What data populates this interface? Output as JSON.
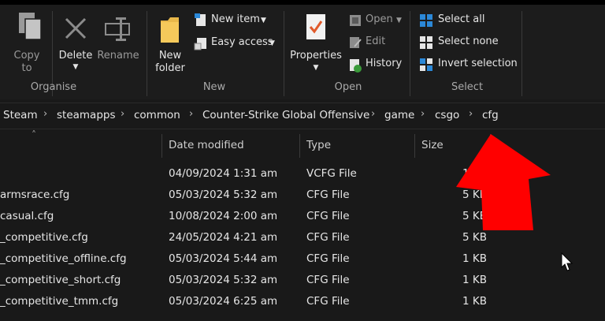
{
  "ribbon": {
    "organise": {
      "label": "Organise",
      "copy_to": "Copy\nto",
      "copy_to_line1": "Copy",
      "copy_to_line2": "to",
      "delete": "Delete",
      "rename": "Rename"
    },
    "new": {
      "label": "New",
      "new_folder_line1": "New",
      "new_folder_line2": "folder",
      "new_item": "New item",
      "easy_access": "Easy access"
    },
    "open": {
      "label": "Open",
      "properties": "Properties",
      "open": "Open",
      "edit": "Edit",
      "history": "History"
    },
    "select": {
      "label": "Select",
      "select_all": "Select all",
      "select_none": "Select none",
      "invert_selection": "Invert selection"
    }
  },
  "breadcrumb": [
    "Steam",
    "steamapps",
    "common",
    "Counter-Strike Global Offensive",
    "game",
    "csgo",
    "cfg"
  ],
  "columns": {
    "date_modified": "Date modified",
    "type": "Type",
    "size": "Size"
  },
  "files": [
    {
      "name": "",
      "date": "04/09/2024 1:31 am",
      "type": "VCFG File",
      "size": "1"
    },
    {
      "name": "armsrace.cfg",
      "date": "05/03/2024 5:32 am",
      "type": "CFG File",
      "size": "5 KB"
    },
    {
      "name": "casual.cfg",
      "date": "10/08/2024 2:00 am",
      "type": "CFG File",
      "size": "5 KB"
    },
    {
      "name": "_competitive.cfg",
      "date": "24/05/2024 4:21 am",
      "type": "CFG File",
      "size": "5 KB"
    },
    {
      "name": "_competitive_offline.cfg",
      "date": "05/03/2024 5:44 am",
      "type": "CFG File",
      "size": "1 KB"
    },
    {
      "name": "_competitive_short.cfg",
      "date": "05/03/2024 5:32 am",
      "type": "CFG File",
      "size": "1 KB"
    },
    {
      "name": "_competitive_tmm.cfg",
      "date": "05/03/2024 6:25 am",
      "type": "CFG File",
      "size": "1 KB"
    }
  ],
  "colors": {
    "background": "#191919",
    "arrow": "#ff0000",
    "accent": "#2b88d8"
  }
}
